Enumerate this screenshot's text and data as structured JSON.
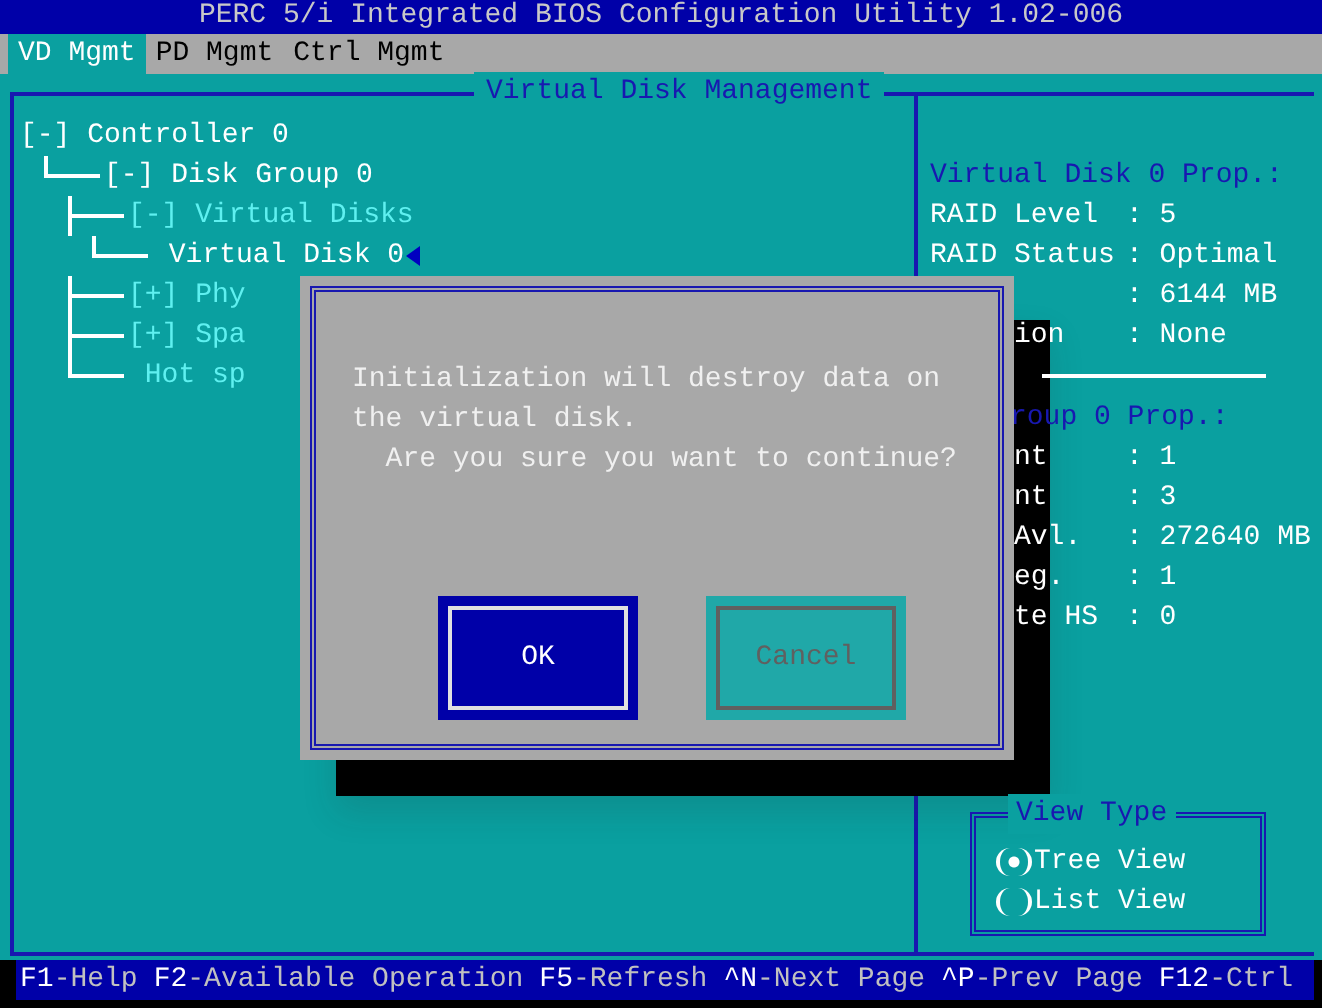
{
  "window": {
    "title": "PERC 5/i Integrated BIOS Configuration Utility 1.02-006"
  },
  "tabs": [
    {
      "label": "VD Mgmt",
      "selected": true
    },
    {
      "label": "PD Mgmt",
      "selected": false
    },
    {
      "label": "Ctrl Mgmt",
      "selected": false
    }
  ],
  "panel": {
    "title": "Virtual Disk Management"
  },
  "tree": [
    {
      "toggle": "[-]",
      "label": "Controller 0",
      "kind": "item",
      "selected": false,
      "children": [
        {
          "toggle": "[-]",
          "label": "Disk Group 0",
          "kind": "item",
          "selected": false,
          "children": [
            {
              "toggle": "[-]",
              "label": "Virtual Disks",
              "kind": "section",
              "selected": false,
              "children": [
                {
                  "label": "Virtual Disk 0",
                  "kind": "item",
                  "selected": true
                }
              ]
            },
            {
              "toggle": "[+]",
              "label": "Phy",
              "kind": "section",
              "selected": false
            },
            {
              "toggle": "[+]",
              "label": "Spa",
              "kind": "section",
              "selected": false
            },
            {
              "label": "Hot sp",
              "kind": "section",
              "selected": false
            }
          ]
        }
      ]
    }
  ],
  "properties": [
    {
      "kind": "heading",
      "label": "Virtual Disk 0 Prop.:"
    },
    {
      "kind": "row",
      "label": "RAID Level",
      "value": ": 5"
    },
    {
      "kind": "row",
      "label": "RAID Status",
      "value": ": Optimal"
    },
    {
      "kind": "row",
      "value": ": 6144 MB"
    },
    {
      "kind": "row",
      "label": "ion",
      "value": ": None",
      "cut": true
    },
    {
      "kind": "rule"
    },
    {
      "kind": "heading",
      "label": "roup 0 Prop.:",
      "cut": true
    },
    {
      "kind": "row",
      "label": "nt",
      "value": ": 1",
      "cut": true
    },
    {
      "kind": "row",
      "label": "nt",
      "value": ": 3",
      "cut": true
    },
    {
      "kind": "row",
      "label": "Avl.",
      "value": ": 272640 MB",
      "cut": true
    },
    {
      "kind": "row",
      "label": "eg.",
      "value": ": 1",
      "cut": true
    },
    {
      "kind": "row",
      "label": "te HS",
      "value": ": 0",
      "cut": true
    }
  ],
  "view_type": {
    "title": "View Type",
    "options": [
      {
        "label": "Tree View",
        "selected": true
      },
      {
        "label": "List View",
        "selected": false
      }
    ]
  },
  "dialog": {
    "lines": [
      "Initialization will destroy data on",
      "the virtual disk.",
      "  Are you sure you want to continue?"
    ],
    "buttons": [
      {
        "label": "OK",
        "selected": true
      },
      {
        "label": "Cancel",
        "selected": false
      }
    ]
  },
  "status_bar": [
    {
      "key": "F1",
      "action": "-Help"
    },
    {
      "key": "F2",
      "action": "-Available Operation"
    },
    {
      "key": "F5",
      "action": "-Refresh"
    },
    {
      "key": "^N",
      "action": "-Next Page"
    },
    {
      "key": "^P",
      "action": "-Prev Page"
    },
    {
      "key": "F12",
      "action": "-Ctrl"
    }
  ]
}
